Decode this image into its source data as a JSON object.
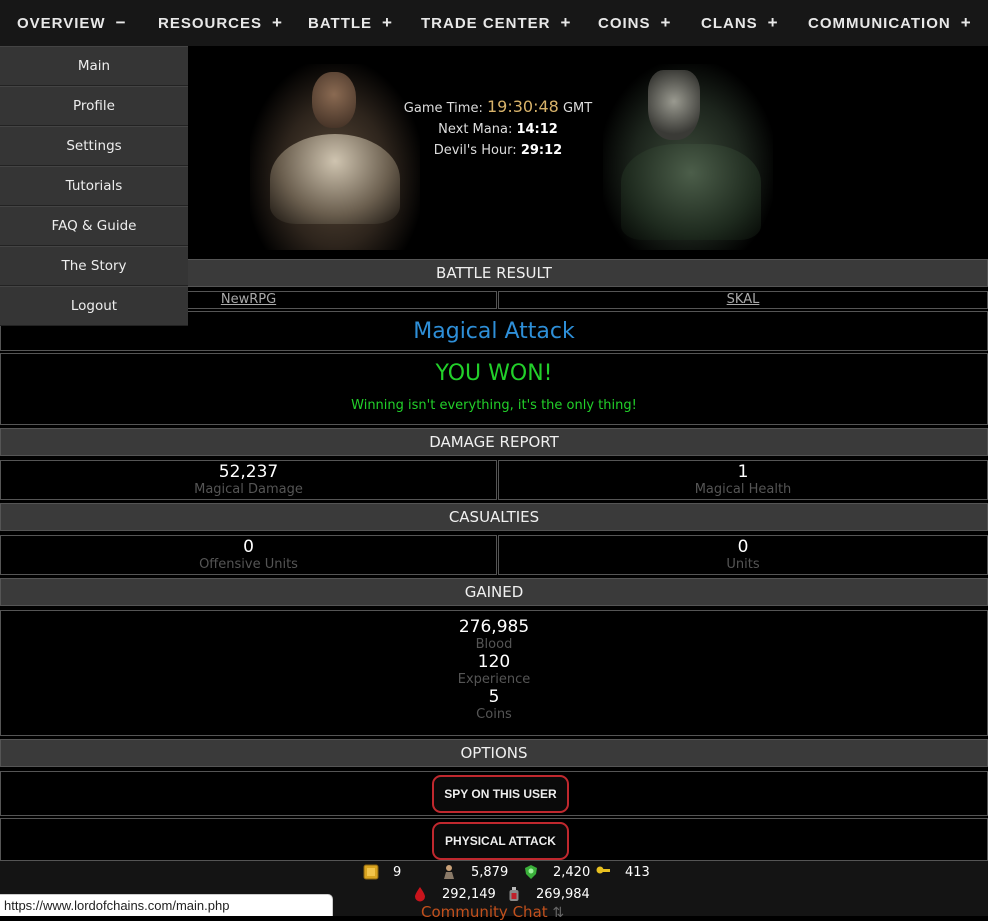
{
  "nav": {
    "items": [
      {
        "label": "OVERVIEW",
        "sign": "−"
      },
      {
        "label": "RESOURCES",
        "sign": "+"
      },
      {
        "label": "BATTLE",
        "sign": "+"
      },
      {
        "label": "TRADE CENTER",
        "sign": "+"
      },
      {
        "label": "COINS",
        "sign": "+"
      },
      {
        "label": "CLANS",
        "sign": "+"
      },
      {
        "label": "COMMUNICATION",
        "sign": "+"
      }
    ]
  },
  "dropdown": {
    "items": [
      "Main",
      "Profile",
      "Settings",
      "Tutorials",
      "FAQ & Guide",
      "The Story",
      "Logout"
    ]
  },
  "banner": {
    "game_time_label": "Game Time:",
    "game_time_value": "19:30:48",
    "game_time_zone": "GMT",
    "next_mana_label": "Next Mana:",
    "next_mana_value": "14:12",
    "devils_hour_label": "Devil's Hour:",
    "devils_hour_value": "29:12"
  },
  "battle": {
    "header": "BATTLE RESULT",
    "attacker": "NewRPG",
    "defender": "SKAL",
    "attack_type": "Magical Attack",
    "result": "YOU WON!",
    "quote": "Winning isn't everything, it's the only thing!"
  },
  "damage": {
    "header": "DAMAGE REPORT",
    "left_value": "52,237",
    "left_label": "Magical Damage",
    "right_value": "1",
    "right_label": "Magical Health"
  },
  "casualties": {
    "header": "CASUALTIES",
    "left_value": "0",
    "left_label": "Offensive Units",
    "right_value": "0",
    "right_label": "Units"
  },
  "gained": {
    "header": "GAINED",
    "blood_value": "276,985",
    "blood_label": "Blood",
    "exp_value": "120",
    "exp_label": "Experience",
    "coins_value": "5",
    "coins_label": "Coins"
  },
  "options": {
    "header": "OPTIONS",
    "spy_label": "SPY ON THIS USER",
    "physical_label": "PHYSICAL ATTACK"
  },
  "resources": {
    "row1": [
      "9",
      "5,879",
      "2,420",
      "413"
    ],
    "row2": [
      "292,149",
      "269,984"
    ]
  },
  "footer": {
    "chat_label": "Community Chat",
    "status_url": "https://www.lordofchains.com/main.php"
  },
  "colors": {
    "attack_blue": "#2e8fd8",
    "win_green": "#22d02a",
    "button_red": "#c0282e",
    "time_gold": "#d8b36a",
    "chat_orange": "#c2501c"
  }
}
